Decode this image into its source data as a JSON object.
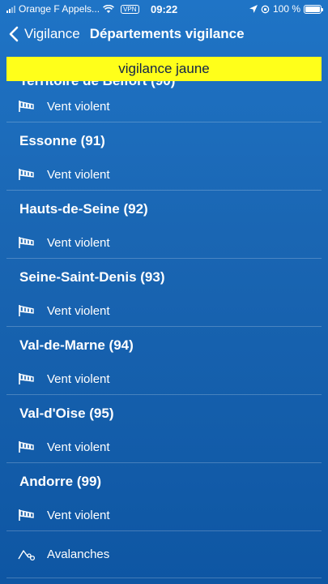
{
  "status_bar": {
    "carrier": "Orange F Appels...",
    "vpn": "VPN",
    "time": "09:22",
    "battery": "100 %"
  },
  "nav": {
    "back_label": "Vigilance",
    "title": "Départements vigilance"
  },
  "banner": {
    "label": "vigilance jaune",
    "color": "#ffff1a"
  },
  "departments": [
    {
      "name": "Territoire de Belfort (90)",
      "hazard": "Vent violent",
      "icon": "wind-icon"
    },
    {
      "name": "Essonne (91)",
      "hazard": "Vent violent",
      "icon": "wind-icon"
    },
    {
      "name": "Hauts-de-Seine (92)",
      "hazard": "Vent violent",
      "icon": "wind-icon"
    },
    {
      "name": "Seine-Saint-Denis (93)",
      "hazard": "Vent violent",
      "icon": "wind-icon"
    },
    {
      "name": "Val-de-Marne (94)",
      "hazard": "Vent violent",
      "icon": "wind-icon"
    },
    {
      "name": "Val-d'Oise (95)",
      "hazard": "Vent violent",
      "icon": "wind-icon"
    },
    {
      "name": "Andorre (99)",
      "hazard": "Vent violent",
      "icon": "wind-icon"
    }
  ],
  "avalanche_row": {
    "label": "Avalanches",
    "icon": "avalanche-icon"
  }
}
